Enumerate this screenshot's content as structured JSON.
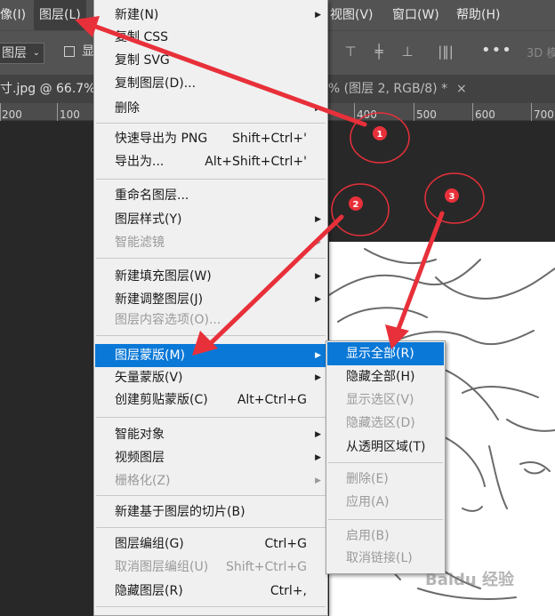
{
  "menubar": {
    "image_fragment": "像(I)",
    "layer": "图层(L)",
    "view": "视图(V)",
    "window": "窗口(W)",
    "help": "帮助(H)"
  },
  "options": {
    "select_value": "图层",
    "checkbox_label": "显",
    "more": "•••",
    "mode3d": "3D 模"
  },
  "tabs": {
    "doc1": "寸.jpg @ 66.7% (",
    "doc2": "0% (图层 2, RGB/8) *",
    "close": "×"
  },
  "ruler": {
    "ticks": [
      "200",
      "100",
      "400",
      "500",
      "600",
      "700"
    ]
  },
  "menu": {
    "items": [
      {
        "label": "新建(N)",
        "shortcut": "",
        "submenu": true,
        "disabled": false
      },
      {
        "label": "复制 CSS",
        "shortcut": "",
        "submenu": false,
        "disabled": false
      },
      {
        "label": "复制 SVG",
        "shortcut": "",
        "submenu": false,
        "disabled": false
      },
      {
        "label": "复制图层(D)...",
        "shortcut": "",
        "submenu": false,
        "disabled": false
      },
      {
        "label": "删除",
        "shortcut": "",
        "submenu": true,
        "disabled": false
      },
      {
        "label": "快速导出为 PNG",
        "shortcut": "Shift+Ctrl+'",
        "submenu": false,
        "disabled": false
      },
      {
        "label": "导出为...",
        "shortcut": "Alt+Shift+Ctrl+'",
        "submenu": false,
        "disabled": false
      },
      {
        "label": "重命名图层...",
        "shortcut": "",
        "submenu": false,
        "disabled": false
      },
      {
        "label": "图层样式(Y)",
        "shortcut": "",
        "submenu": true,
        "disabled": false
      },
      {
        "label": "智能滤镜",
        "shortcut": "",
        "submenu": true,
        "disabled": true
      },
      {
        "label": "新建填充图层(W)",
        "shortcut": "",
        "submenu": true,
        "disabled": false
      },
      {
        "label": "新建调整图层(J)",
        "shortcut": "",
        "submenu": true,
        "disabled": false
      },
      {
        "label": "图层内容选项(O)...",
        "shortcut": "",
        "submenu": false,
        "disabled": true
      },
      {
        "label": "图层蒙版(M)",
        "shortcut": "",
        "submenu": true,
        "disabled": false,
        "highlighted": true
      },
      {
        "label": "矢量蒙版(V)",
        "shortcut": "",
        "submenu": true,
        "disabled": false
      },
      {
        "label": "创建剪贴蒙版(C)",
        "shortcut": "Alt+Ctrl+G",
        "submenu": false,
        "disabled": false
      },
      {
        "label": "智能对象",
        "shortcut": "",
        "submenu": true,
        "disabled": false
      },
      {
        "label": "视频图层",
        "shortcut": "",
        "submenu": true,
        "disabled": false
      },
      {
        "label": "栅格化(Z)",
        "shortcut": "",
        "submenu": true,
        "disabled": true
      },
      {
        "label": "新建基于图层的切片(B)",
        "shortcut": "",
        "submenu": false,
        "disabled": false
      },
      {
        "label": "图层编组(G)",
        "shortcut": "Ctrl+G",
        "submenu": false,
        "disabled": false
      },
      {
        "label": "取消图层编组(U)",
        "shortcut": "Shift+Ctrl+G",
        "submenu": false,
        "disabled": true
      },
      {
        "label": "隐藏图层(R)",
        "shortcut": "Ctrl+,",
        "submenu": false,
        "disabled": false
      }
    ]
  },
  "submenu": {
    "items": [
      {
        "label": "显示全部(R)",
        "disabled": false,
        "highlighted": true
      },
      {
        "label": "隐藏全部(H)",
        "disabled": false
      },
      {
        "label": "显示选区(V)",
        "disabled": true
      },
      {
        "label": "隐藏选区(D)",
        "disabled": true
      },
      {
        "label": "从透明区域(T)",
        "disabled": false
      },
      {
        "label": "删除(E)",
        "disabled": true
      },
      {
        "label": "应用(A)",
        "disabled": true
      },
      {
        "label": "启用(B)",
        "disabled": true
      },
      {
        "label": "取消链接(L)",
        "disabled": true
      }
    ]
  },
  "annotations": {
    "badge1": "1",
    "badge2": "2",
    "badge3": "3",
    "arrow_color": "#e8303a"
  },
  "watermark": "Baidu 经验"
}
